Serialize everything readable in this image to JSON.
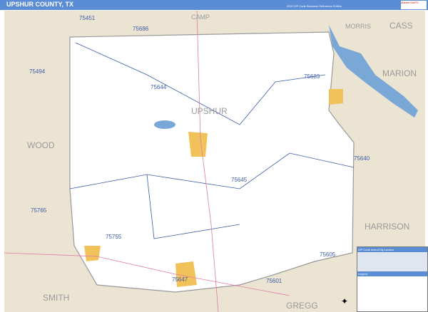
{
  "header": {
    "title": "UPSHUR COUNTY, TX",
    "subtitle": "2020 ZIP Code Business Reference Edition",
    "logo": "Market MAPS"
  },
  "labels": {
    "county": "UPSHUR",
    "neighbors": [
      "CAMP",
      "MORRIS",
      "CASS",
      "MARION",
      "WOOD",
      "HARRISON",
      "SMITH",
      "GREGG"
    ],
    "zips": [
      "75451",
      "75686",
      "75494",
      "75644",
      "75683",
      "75640",
      "75645",
      "75765",
      "75755",
      "75605",
      "75647",
      "75601"
    ]
  },
  "legend": {
    "title": "ZIP Code Index/City Locator",
    "section": "Legend"
  },
  "colors": {
    "header": "#5b8dd6",
    "outside": "#ece4d2",
    "county": "#ffffff",
    "water": "#7aa8d6",
    "city": "#f2c25a"
  }
}
